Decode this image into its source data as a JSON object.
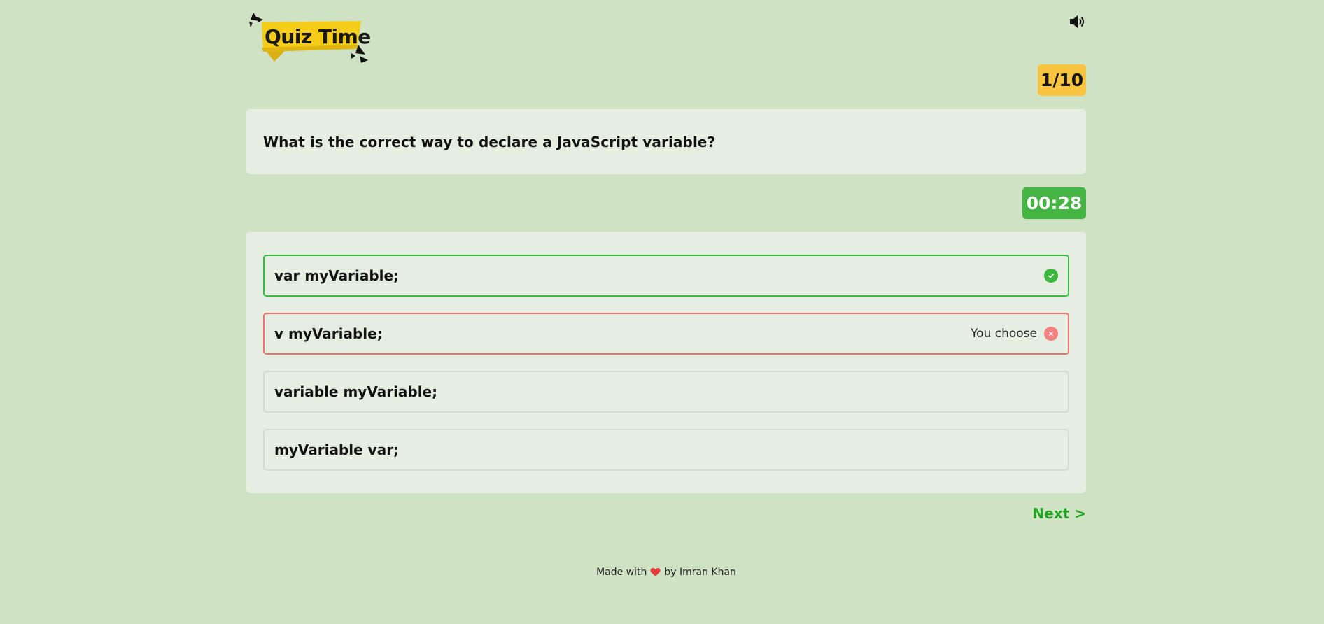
{
  "header": {
    "logo_text": "Quiz Time",
    "sound_icon": "speaker-volume-icon"
  },
  "progress": {
    "counter": "1/10"
  },
  "question": {
    "text": "What is the correct way to declare a JavaScript variable?"
  },
  "timer": {
    "value": "00:28"
  },
  "options": [
    {
      "label": "var myVariable;",
      "state": "correct",
      "icon": "check-icon"
    },
    {
      "label": "v myVariable;",
      "state": "wrong",
      "icon": "close-icon",
      "note": "You choose"
    },
    {
      "label": "variable myVariable;",
      "state": "neutral"
    },
    {
      "label": "myVariable var;",
      "state": "neutral"
    }
  ],
  "navigation": {
    "next_label": "Next >"
  },
  "footer": {
    "made_with": "Made with",
    "heart_icon": "heart-icon",
    "by": "by Imran Khan"
  },
  "colors": {
    "background": "#cfe3c4",
    "card": "#e5eee0",
    "counter_badge": "#f9c440",
    "timer": "#44b543",
    "correct": "#3db83e",
    "wrong": "#f06f6f",
    "next": "#23a523",
    "logo_yellow": "#f5cc17"
  }
}
